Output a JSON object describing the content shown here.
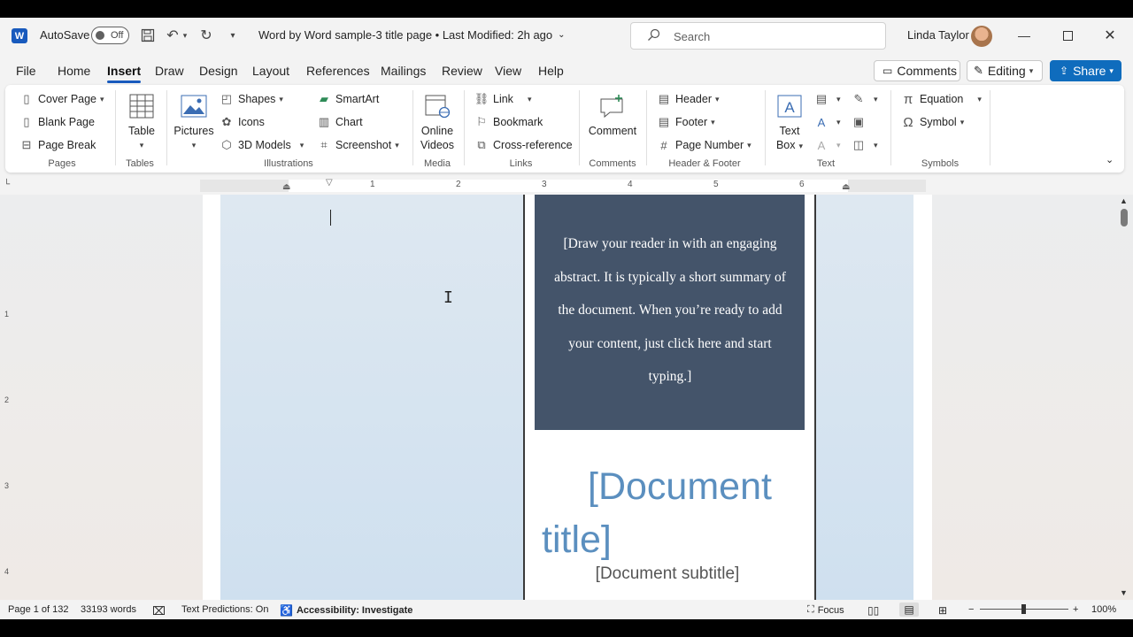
{
  "titlebar": {
    "app_icon": "W",
    "autosave_label": "AutoSave",
    "autosave_state": "Off",
    "doc_title": "Word by Word sample-3 title page • Last Modified: 2h ago",
    "search_placeholder": "Search",
    "user_name": "Linda Taylor"
  },
  "tabs": [
    "File",
    "Home",
    "Insert",
    "Draw",
    "Design",
    "Layout",
    "References",
    "Mailings",
    "Review",
    "View",
    "Help"
  ],
  "right_buttons": {
    "comments": "Comments",
    "editing": "Editing",
    "share": "Share"
  },
  "ribbon": {
    "pages": {
      "label": "Pages",
      "cover_page": "Cover Page",
      "blank_page": "Blank Page",
      "page_break": "Page Break"
    },
    "tables": {
      "label": "Tables",
      "table": "Table"
    },
    "illustrations": {
      "label": "Illustrations",
      "pictures": "Pictures",
      "shapes": "Shapes",
      "icons": "Icons",
      "models": "3D Models",
      "smartart": "SmartArt",
      "chart": "Chart",
      "screenshot": "Screenshot"
    },
    "media": {
      "label": "Media",
      "online": "Online",
      "videos": "Videos"
    },
    "links": {
      "label": "Links",
      "link": "Link",
      "bookmark": "Bookmark",
      "cross_reference": "Cross-reference"
    },
    "comments": {
      "label": "Comments",
      "comment": "Comment"
    },
    "header_footer": {
      "label": "Header & Footer",
      "header": "Header",
      "footer": "Footer",
      "page_number": "Page Number"
    },
    "text": {
      "label": "Text",
      "text": "Text",
      "box": "Box"
    },
    "symbols": {
      "label": "Symbols",
      "equation": "Equation",
      "symbol": "Symbol"
    }
  },
  "ruler": {
    "numbers": [
      "1",
      "2",
      "3",
      "4",
      "5",
      "6"
    ]
  },
  "vruler": {
    "numbers": [
      "1",
      "2",
      "3",
      "4"
    ]
  },
  "document": {
    "abstract": "[Draw your reader in with an engaging abstract. It is typically a short summary of the document. When you’re ready to add your content, just click here and start typing.]",
    "title": "[Document title]",
    "subtitle": "[Document subtitle]"
  },
  "status": {
    "page": "Page 1 of 132",
    "words": "33193 words",
    "predictions": "Text Predictions: On",
    "accessibility": "Accessibility: Investigate",
    "focus": "Focus",
    "zoom": "100%"
  },
  "colors": {
    "accent": "#185abd",
    "abstract_bg": "#44546a",
    "title_blue": "#5b8fbf",
    "share_blue": "#0f6cbd"
  }
}
